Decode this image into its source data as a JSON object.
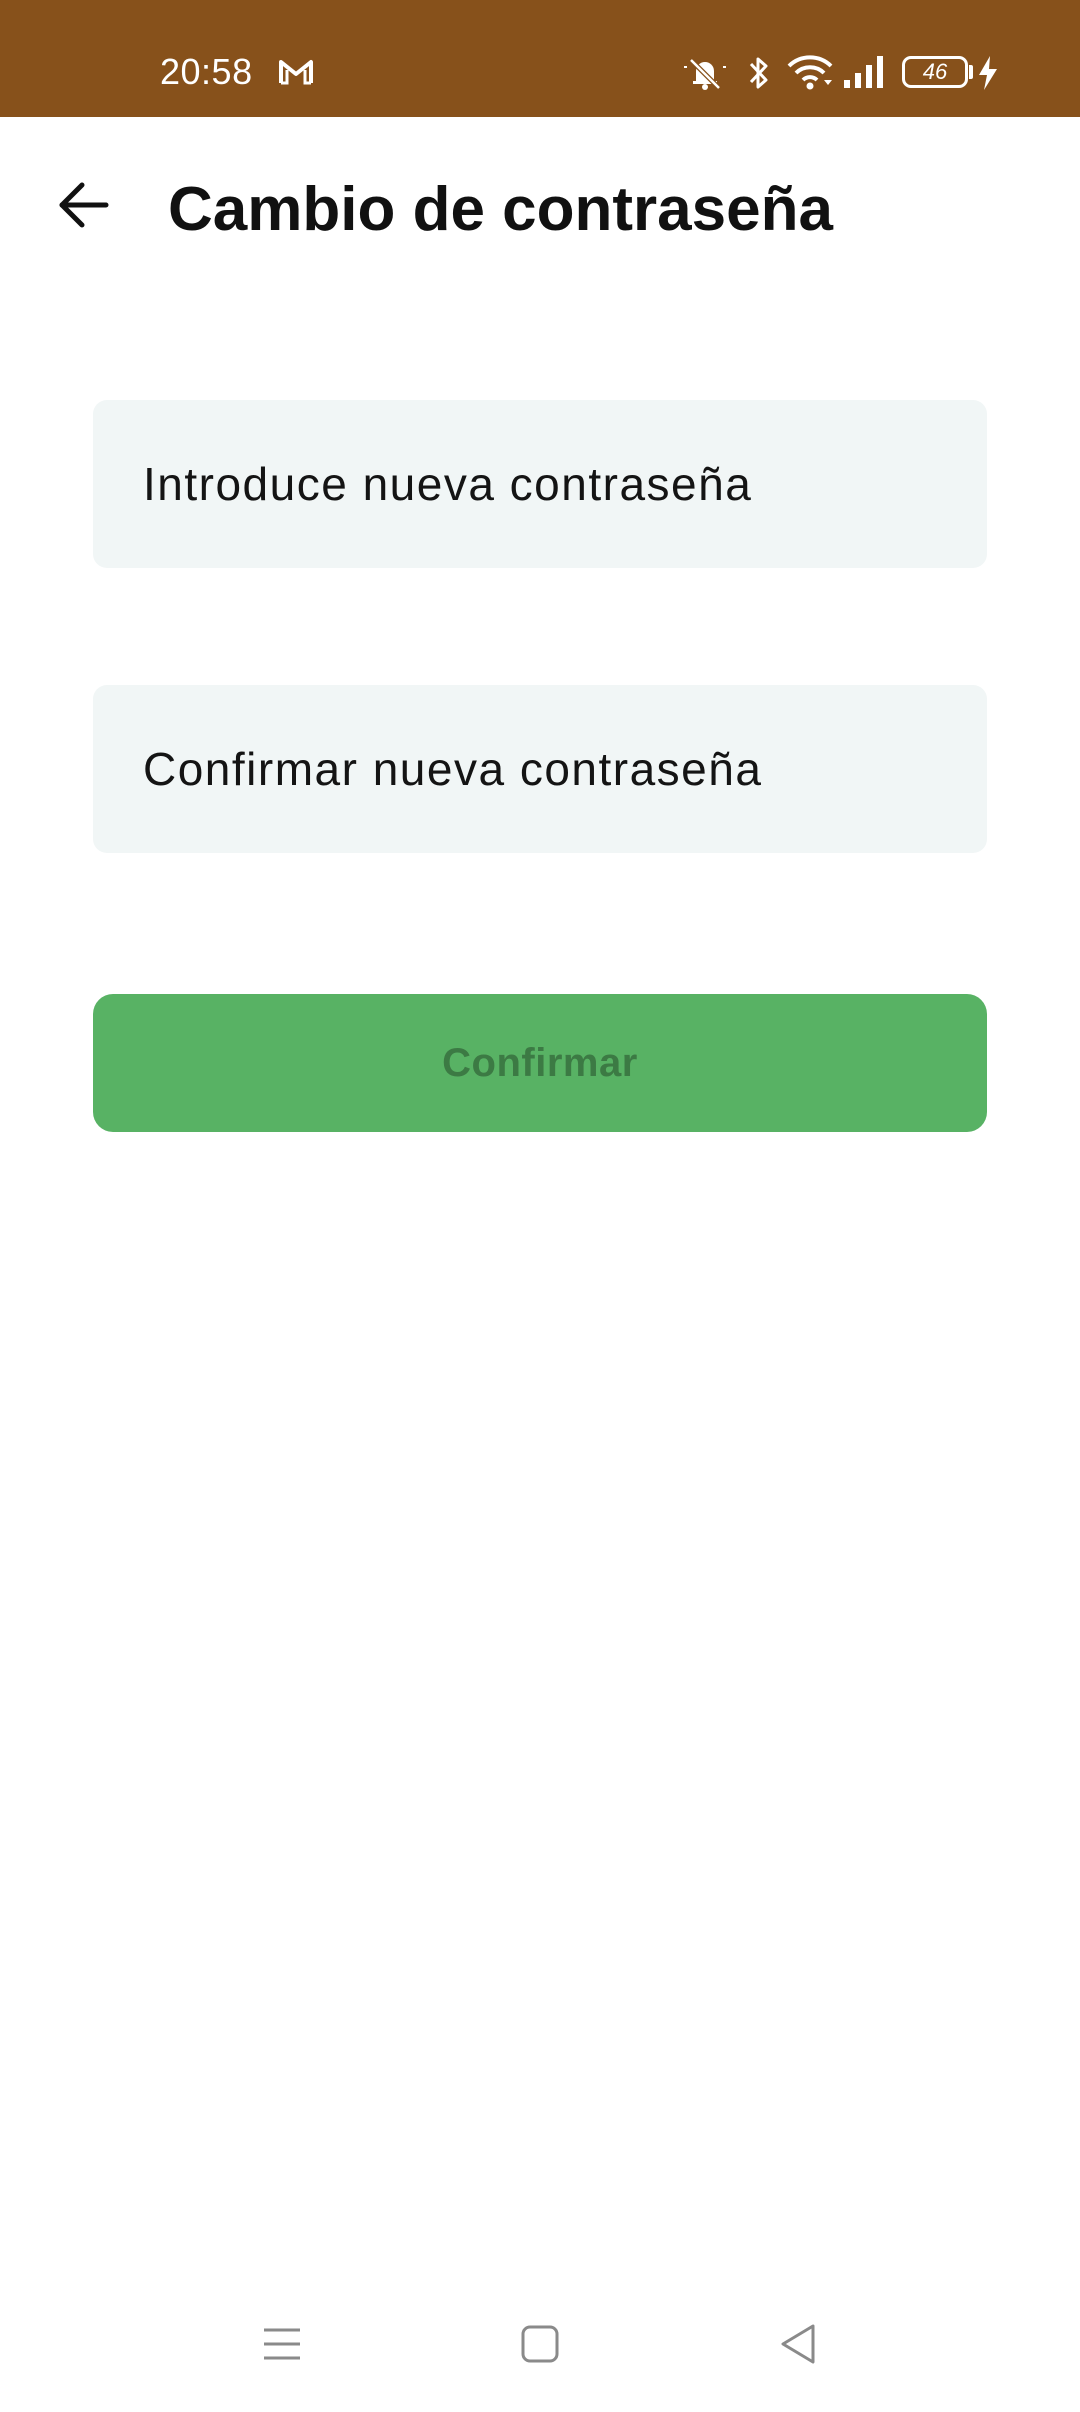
{
  "status_bar": {
    "time": "20:58",
    "battery_level": "46",
    "icons": [
      "gmail-icon",
      "mute-bell-icon",
      "bluetooth-icon",
      "wifi-icon",
      "signal-icon",
      "battery-icon",
      "charging-icon"
    ]
  },
  "header": {
    "title": "Cambio de contraseña",
    "back_icon": "arrow-left-icon"
  },
  "form": {
    "new_password_placeholder": "Introduce nueva contraseña",
    "new_password_value": "",
    "confirm_password_placeholder": "Confirmar nueva contraseña",
    "confirm_password_value": "",
    "confirm_button_label": "Confirmar"
  },
  "nav_bar": {
    "icons": [
      "menu-icon",
      "home-square-icon",
      "back-triangle-icon"
    ]
  },
  "colors": {
    "status_bar_bg": "#87511b",
    "field_bg": "#f1f6f6",
    "button_bg": "#58b264",
    "button_text": "#3c7a44"
  }
}
